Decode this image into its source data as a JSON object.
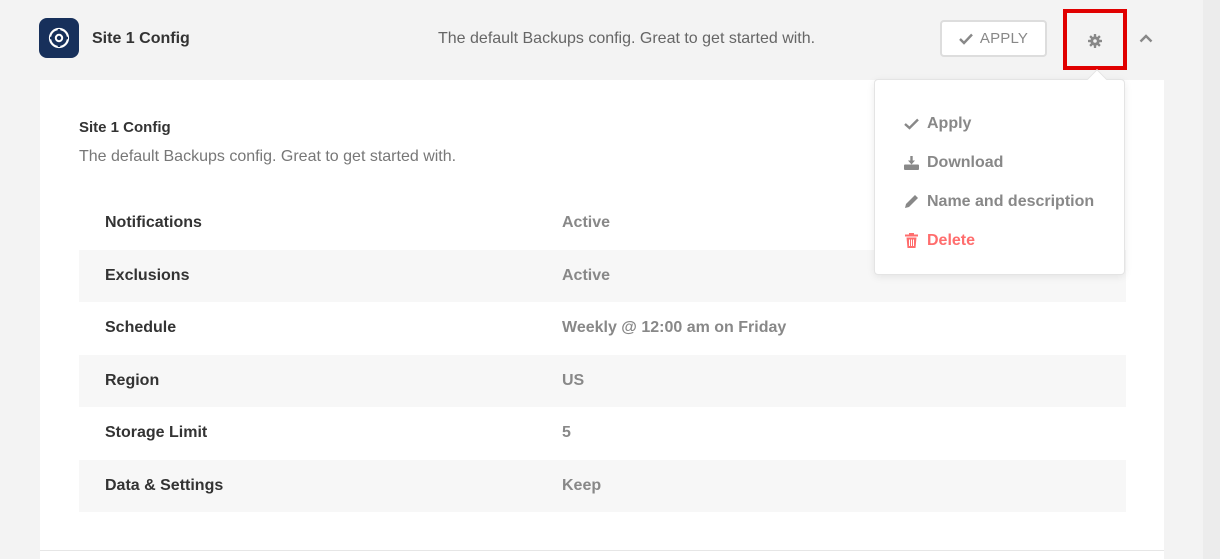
{
  "header": {
    "title": "Site 1 Config",
    "description": "The default Backups config. Great to get started with.",
    "apply_label": "APPLY"
  },
  "detail": {
    "title": "Site 1 Config",
    "description": "The default Backups config. Great to get started with."
  },
  "rows": [
    {
      "label": "Notifications",
      "value": "Active"
    },
    {
      "label": "Exclusions",
      "value": "Active"
    },
    {
      "label": "Schedule",
      "value": "Weekly @ 12:00 am on Friday"
    },
    {
      "label": "Region",
      "value": "US"
    },
    {
      "label": "Storage Limit",
      "value": "5"
    },
    {
      "label": "Data & Settings",
      "value": "Keep"
    }
  ],
  "menu": {
    "apply": "Apply",
    "download": "Download",
    "rename": "Name and description",
    "delete": "Delete"
  },
  "colors": {
    "logo_bg": "#17305b",
    "highlight": "#e00000",
    "danger": "#ff6d6d",
    "muted": "#888888"
  },
  "icons": [
    "backup-logo-icon",
    "check-icon",
    "gear-icon",
    "chevron-up-icon",
    "download-icon",
    "pencil-icon",
    "trash-icon"
  ]
}
